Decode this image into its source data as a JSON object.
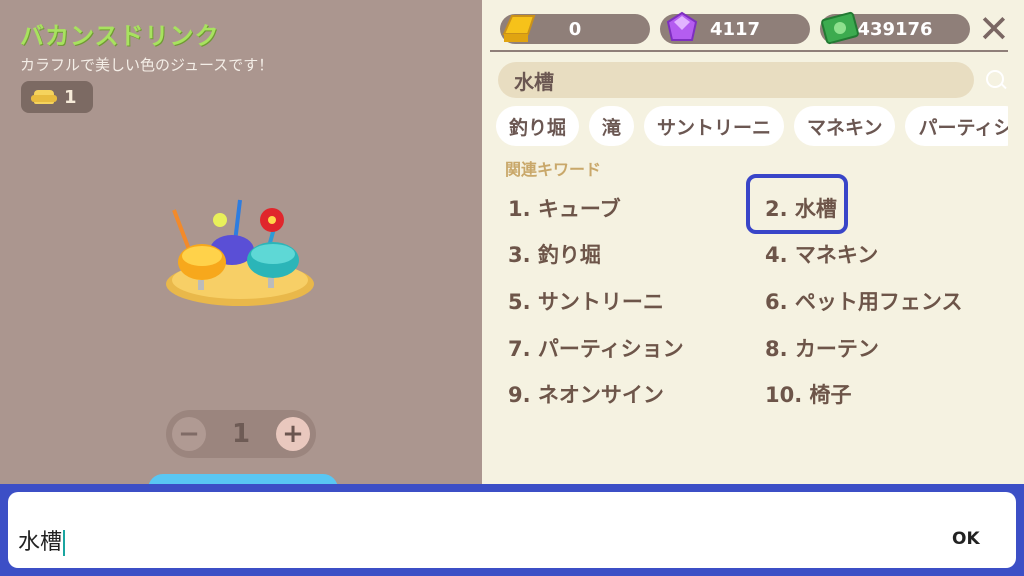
{
  "item": {
    "title": "バカンスドリンク",
    "description": "カラフルで美しい色のジュースです！",
    "owned_count": "1"
  },
  "stepper": {
    "minus": "−",
    "value": "1",
    "plus": "+"
  },
  "currencies": {
    "gold": "0",
    "gems": "4117",
    "cash": "439176"
  },
  "close_label": "✕",
  "search": {
    "value": "水槽"
  },
  "chips": [
    "釣り堀",
    "滝",
    "サントリーニ",
    "マネキン",
    "パーティシ"
  ],
  "keywords_title": "関連キワード",
  "keywords": [
    "1. キューブ",
    "2. 水槽",
    "3. 釣り堀",
    "4. マネキン",
    "5. サントリーニ",
    "6. ペット用フェンス",
    "7. パーティション",
    "8. カーテン",
    "9. ネオンサイン",
    "10. 椅子"
  ],
  "ime": {
    "text": "水槽",
    "ok_label": "OK"
  },
  "colors": {
    "highlight": "#3945c8",
    "title_green": "#a8e25f"
  }
}
